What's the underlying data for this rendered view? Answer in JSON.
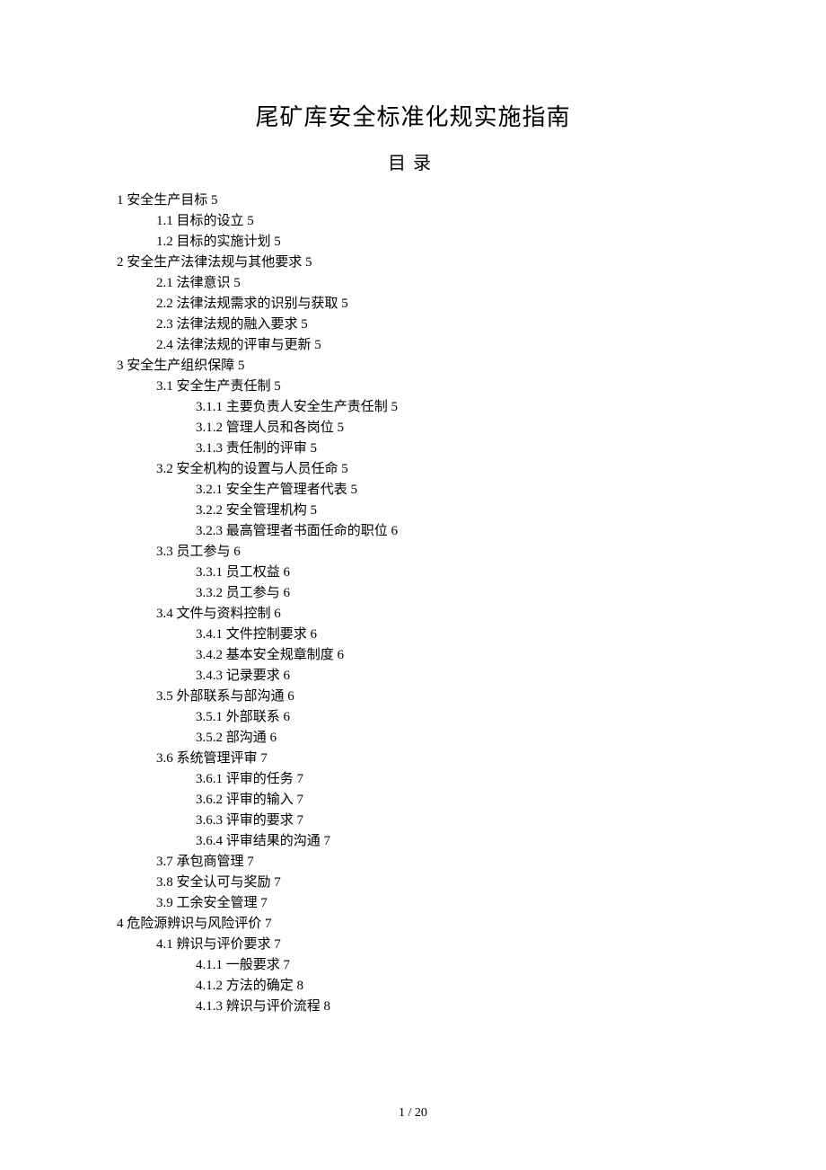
{
  "title": "尾矿库安全标准化规实施指南",
  "subtitle": "目录",
  "toc": [
    {
      "level": 0,
      "num": "1",
      "text": "安全生产目标",
      "page": "5"
    },
    {
      "level": 1,
      "num": "1.1",
      "text": "目标的设立",
      "page": "5"
    },
    {
      "level": 1,
      "num": "1.2",
      "text": "目标的实施计划",
      "page": "5"
    },
    {
      "level": 0,
      "num": "2",
      "text": "安全生产法律法规与其他要求",
      "page": "5"
    },
    {
      "level": 1,
      "num": "2.1",
      "text": "法律意识",
      "page": "5"
    },
    {
      "level": 1,
      "num": "2.2",
      "text": "法律法规需求的识别与获取",
      "page": "5"
    },
    {
      "level": 1,
      "num": "2.3",
      "text": "法律法规的融入要求",
      "page": "5"
    },
    {
      "level": 1,
      "num": "2.4",
      "text": "法律法规的评审与更新",
      "page": "5"
    },
    {
      "level": 0,
      "num": "3",
      "text": "安全生产组织保障",
      "page": "5"
    },
    {
      "level": 1,
      "num": "3.1",
      "text": "安全生产责任制",
      "page": "5"
    },
    {
      "level": 2,
      "num": "3.1.1",
      "text": "主要负责人安全生产责任制",
      "page": "5"
    },
    {
      "level": 2,
      "num": "3.1.2",
      "text": "管理人员和各岗位",
      "page": "5"
    },
    {
      "level": 2,
      "num": "3.1.3",
      "text": "责任制的评审",
      "page": "5"
    },
    {
      "level": 1,
      "num": "3.2",
      "text": "安全机构的设置与人员任命",
      "page": "5"
    },
    {
      "level": 2,
      "num": "3.2.1",
      "text": "安全生产管理者代表",
      "page": "5"
    },
    {
      "level": 2,
      "num": "3.2.2",
      "text": "安全管理机构",
      "page": "5"
    },
    {
      "level": 2,
      "num": "3.2.3",
      "text": "最高管理者书面任命的职位",
      "page": "6"
    },
    {
      "level": 1,
      "num": "3.3",
      "text": "员工参与",
      "page": "6"
    },
    {
      "level": 2,
      "num": "3.3.1",
      "text": "员工权益",
      "page": "6"
    },
    {
      "level": 2,
      "num": "3.3.2",
      "text": "员工参与",
      "page": "6"
    },
    {
      "level": 1,
      "num": "3.4",
      "text": "文件与资料控制",
      "page": "6"
    },
    {
      "level": 2,
      "num": "3.4.1",
      "text": "文件控制要求",
      "page": "6"
    },
    {
      "level": 2,
      "num": "3.4.2",
      "text": "基本安全规章制度",
      "page": "6"
    },
    {
      "level": 2,
      "num": "3.4.3",
      "text": "记录要求",
      "page": "6"
    },
    {
      "level": 1,
      "num": "3.5",
      "text": "外部联系与部沟通",
      "page": "6"
    },
    {
      "level": 2,
      "num": "3.5.1",
      "text": "外部联系",
      "page": "6"
    },
    {
      "level": 2,
      "num": "3.5.2",
      "text": "部沟通",
      "page": "6"
    },
    {
      "level": 1,
      "num": "3.6",
      "text": "系统管理评审",
      "page": "7"
    },
    {
      "level": 2,
      "num": "3.6.1",
      "text": "评审的任务",
      "page": "7",
      "tight": true
    },
    {
      "level": 2,
      "num": "3.6.2",
      "text": "评审的输入",
      "page": "7",
      "tight": true
    },
    {
      "level": 2,
      "num": "3.6.3",
      "text": "评审的要求",
      "page": "7",
      "tight": true
    },
    {
      "level": 2,
      "num": "3.6.4",
      "text": "评审结果的沟通",
      "page": "7",
      "tight": true
    },
    {
      "level": 1,
      "num": "3.7",
      "text": "承包商管理",
      "page": "7",
      "tight": true
    },
    {
      "level": 1,
      "num": "3.8",
      "text": "安全认可与奖励",
      "page": "7"
    },
    {
      "level": 1,
      "num": "3.9",
      "text": "工余安全管理",
      "page": "7"
    },
    {
      "level": 0,
      "num": "4",
      "text": "危险源辨识与风险评价",
      "page": "7"
    },
    {
      "level": 1,
      "num": "4.1",
      "text": "辨识与评价要求",
      "page": "7"
    },
    {
      "level": 2,
      "num": "4.1.1",
      "text": "一般要求",
      "page": "7"
    },
    {
      "level": 2,
      "num": "4.1.2",
      "text": "方法的确定",
      "page": "8"
    },
    {
      "level": 2,
      "num": "4.1.3",
      "text": "辨识与评价流程",
      "page": "8"
    }
  ],
  "footer": "1 / 20"
}
